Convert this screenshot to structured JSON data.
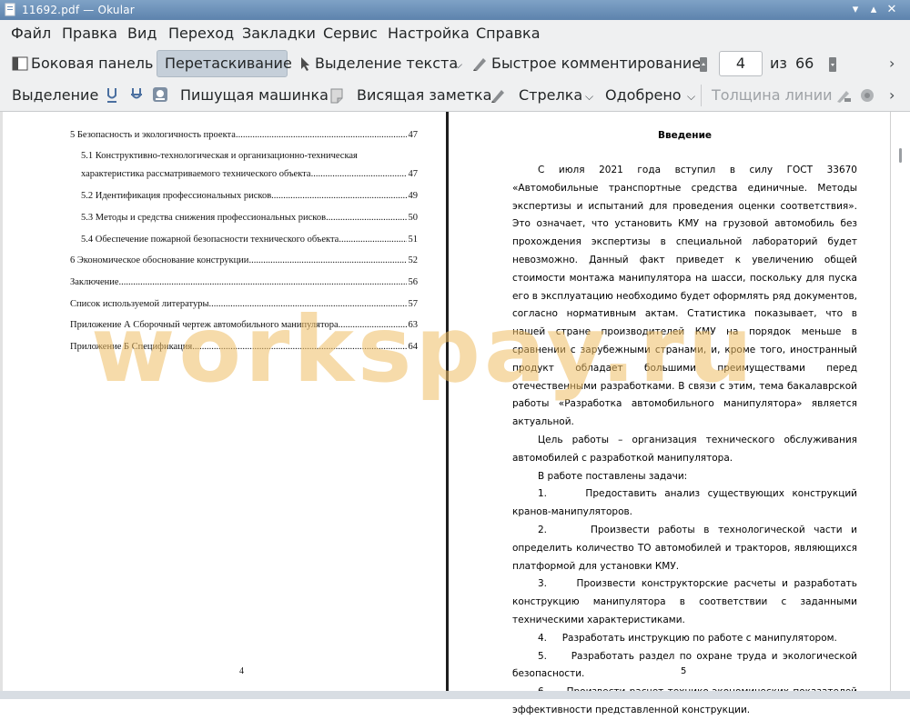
{
  "window": {
    "title": "11692.pdf — Okular",
    "controls": [
      "▾",
      "▴",
      "✕"
    ]
  },
  "menubar": [
    "Файл",
    "Правка",
    "Вид",
    "Переход",
    "Закладки",
    "Сервис",
    "Настройка",
    "Справка"
  ],
  "toolbar1": {
    "sidebar_label": "Боковая панель",
    "drag_label": "Перетаскивание",
    "text_select_label": "Выделение текста",
    "quick_comment_label": "Быстрое комментирование",
    "page_current": "4",
    "page_of_label": "из",
    "page_total": "66"
  },
  "toolbar2": {
    "select_label": "Выделение",
    "typewriter_label": "Пишущая машинка",
    "sticky_note_label": "Висящая заметка",
    "arrow_label": "Стрелка",
    "approved_label": "Одобрено",
    "line_width_label": "Толщина линии"
  },
  "left_page": {
    "toc": [
      {
        "text": "5 Безопасность и экологичность проекта",
        "page": "47"
      },
      {
        "text": "5.1 Конструктивно-технологическая и организационно-техническая",
        "line2": "характеристика рассматриваемого технического объекта",
        "page": "47"
      },
      {
        "text": "5.2 Идентификация профессиональных рисков",
        "page": "49"
      },
      {
        "text": "5.3 Методы и средства снижения профессиональных рисков",
        "page": "50"
      },
      {
        "text": "5.4 Обеспечение пожарной безопасности технического объекта",
        "page": "51"
      },
      {
        "text": "6 Экономическое обоснование конструкции",
        "page": "52"
      },
      {
        "text": "Заключение",
        "page": "56"
      },
      {
        "text": "Список используемой литературы",
        "page": "57"
      },
      {
        "text": "Приложение А Сборочный чертеж автомобильного манипулятора",
        "page": "63"
      },
      {
        "text": "Приложение Б Спецификация",
        "page": "64"
      }
    ],
    "page_number": "4"
  },
  "right_page": {
    "heading": "Введение",
    "para1": "С июля 2021 года вступил в силу ГОСТ 33670 «Автомобильные транспортные средства единичные. Методы экспертизы и испытаний для проведения оценки соответствия». Это означает, что установить КМУ на грузовой автомобиль без прохождения экспертизы в специальной лабораторий будет невозможно. Данный факт приведет к увеличению общей стоимости монтажа манипулятора на шасси, поскольку для пуска его в эксплуатацию необходимо будет оформлять ряд документов, согласно нормативным актам. Статистика показывает, что в нашей стране производителей КМУ на порядок меньше в сравнении с зарубежными странами, и, кроме того, иностранный продукт обладает большими преимуществами перед отечественными разработками. В связи с этим, тема бакалаврской работы «Разработка автомобильного манипулятора» является актуальной.",
    "para2": "Цель работы – организация технического обслуживания автомобилей с разработкой манипулятора.",
    "para3": "В работе поставлены задачи:",
    "tasks": [
      "1.     Предоставить анализ существующих конструкций кранов-манипуляторов.",
      "2.     Произвести работы в технологической части и определить количество ТО автомобилей и тракторов, являющихся платформой для установки КМУ.",
      "3.     Произвести конструкторские расчеты и разработать конструкцию манипулятора в соответствии с заданными техническими характеристиками.",
      "4.     Разработать инструкцию по работе с манипулятором.",
      "5.     Разработать раздел по охране труда и экологической безопасности.",
      "6.     Произвести расчет технико-экономических показателей эффективности представленной конструкции."
    ],
    "page_number": "5"
  },
  "watermark": "workspay.ru",
  "colors": {
    "titlebar": "#6b8fb8",
    "chrome": "#eff0f1",
    "active_tool": "#c5cfd9",
    "watermark": "#eebe64"
  },
  "icons": [
    "app-icon",
    "sidebar-icon",
    "cursor-icon",
    "quick-comment-icon",
    "page-prev-icon",
    "page-next-icon",
    "overflow-icon",
    "underline-icon",
    "highlight-icon",
    "stamp-icon",
    "typewriter-icon",
    "sticky-note-icon",
    "arrow-tool-icon"
  ]
}
